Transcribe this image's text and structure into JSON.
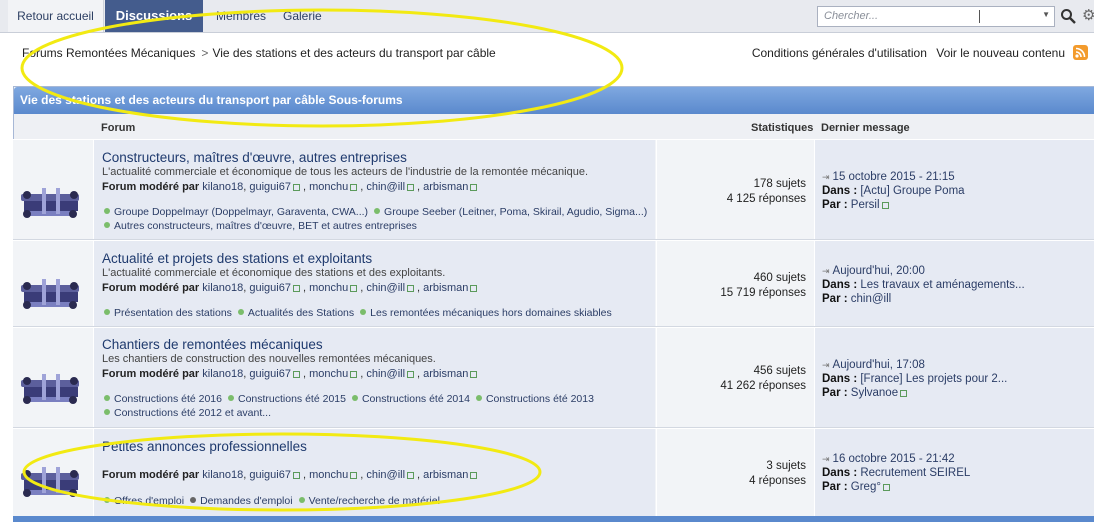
{
  "nav": {
    "back": "Retour accueil",
    "active": "Discussions",
    "members": "Membres",
    "gallery": "Galerie",
    "search_placeholder": "Chercher..."
  },
  "breadcrumb": {
    "root": "Forums Remontées Mécaniques",
    "sep": ">",
    "current": "Vie des stations et des acteurs du transport par câble"
  },
  "header_links": {
    "terms": "Conditions générales d'utilisation",
    "new_content": "Voir le nouveau contenu"
  },
  "category": {
    "title": "Vie des stations et des acteurs du transport par câble Sous-forums",
    "col_forum": "Forum",
    "col_stats": "Statistiques",
    "col_last": "Dernier message"
  },
  "labels": {
    "moderated_by": "Forum modéré par",
    "in": "Dans :",
    "by": "Par :"
  },
  "forums": [
    {
      "title": "Constructeurs, maîtres d'œuvre, autres entreprises",
      "desc": "L'actualité commerciale et économique de tous les acteurs de l'industrie de la remontée mécanique.",
      "mods": [
        "kilano18",
        "guigui67",
        "monchu",
        "chin@ill",
        "arbisman"
      ],
      "subs": [
        "Groupe Doppelmayr (Doppelmayr, Garaventa, CWA...)",
        "Groupe Seeber (Leitner, Poma, Skirail, Agudio, Sigma...)",
        "Autres constructeurs, maîtres d'œuvre, BET et autres entreprises"
      ],
      "topics": "178 sujets",
      "replies": "4 125 réponses",
      "last_date": "15 octobre 2015 - 21:15",
      "last_in": "[Actu] Groupe Poma",
      "last_by": "Persil"
    },
    {
      "title": "Actualité et projets des stations et exploitants",
      "desc": "L'actualité commerciale et économique des stations et des exploitants.",
      "mods": [
        "kilano18",
        "guigui67",
        "monchu",
        "chin@ill",
        "arbisman"
      ],
      "subs": [
        "Présentation des stations",
        "Actualités des Stations",
        "Les remontées mécaniques hors domaines skiables"
      ],
      "topics": "460 sujets",
      "replies": "15 719 réponses",
      "last_date": "Aujourd'hui, 20:00",
      "last_in": "Les travaux et aménagements...",
      "last_by": "chin@ill"
    },
    {
      "title": "Chantiers de remontées mécaniques",
      "desc": "Les chantiers de construction des nouvelles remontées mécaniques.",
      "mods": [
        "kilano18",
        "guigui67",
        "monchu",
        "chin@ill",
        "arbisman"
      ],
      "subs": [
        "Constructions été 2016",
        "Constructions été 2015",
        "Constructions été 2014",
        "Constructions été 2013",
        "Constructions été 2012 et avant..."
      ],
      "topics": "456 sujets",
      "replies": "41 262 réponses",
      "last_date": "Aujourd'hui, 17:08",
      "last_in": "[France] Les projets pour 2...",
      "last_by": "Sylvanoe"
    },
    {
      "title": "Petites annonces professionnelles",
      "desc": "",
      "mods": [
        "kilano18",
        "guigui67",
        "monchu",
        "chin@ill",
        "arbisman"
      ],
      "subs": [
        "Offres d'emploi",
        "Demandes d'emploi",
        "Vente/recherche de matériel"
      ],
      "topics": "3 sujets",
      "replies": "4 réponses",
      "last_date": "16 octobre 2015 - 21:42",
      "last_in": "Recrutement SEIREL",
      "last_by": "Greg°"
    }
  ],
  "colors": {
    "nav_active": "#445c8d",
    "cat_header": "#5a89cd",
    "annotation": "#f2ea12",
    "rss": "#f39b2c"
  }
}
